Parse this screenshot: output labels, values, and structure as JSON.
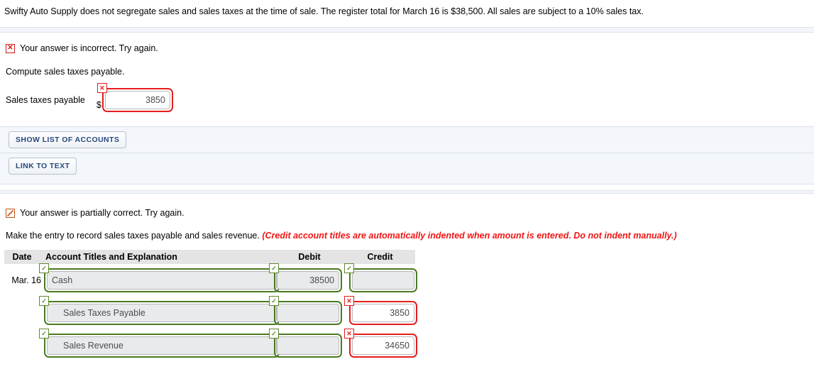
{
  "intro": {
    "text": "Swifty Auto Supply does not segregate sales and sales taxes at the time of sale. The register total for March 16 is $38,500. All sales are subject to a 10% sales tax."
  },
  "part_one": {
    "feedback": {
      "icon": "x-mark-icon",
      "icon_glyph": "✕",
      "text": "Your answer is incorrect.  Try again.",
      "status": "incorrect",
      "color": "#d11a1a"
    },
    "prompt": "Compute sales taxes payable.",
    "field": {
      "label": "Sales taxes payable",
      "currency_symbol": "$",
      "value": "3850",
      "placeholder": "",
      "status": "incorrect",
      "badge_glyph": "✕"
    },
    "buttons": [
      {
        "name": "show-list-of-accounts-button",
        "label": "SHOW LIST OF ACCOUNTS"
      },
      {
        "name": "link-to-text-button",
        "label": "LINK TO TEXT"
      }
    ]
  },
  "part_two": {
    "feedback": {
      "icon": "partial-slash-icon",
      "icon_glyph": "╱",
      "text": "Your answer is partially correct.  Try again.",
      "status": "partial",
      "color": "#c4531a"
    },
    "prompt": "Make the entry to record sales taxes payable and sales revenue.",
    "prompt_note": "(Credit account titles are automatically indented when amount is entered. Do not indent manually.)",
    "table": {
      "headers": [
        "Date",
        "Account Titles and Explanation",
        "Debit",
        "Credit"
      ],
      "rows": [
        {
          "date": "Mar. 16",
          "account": {
            "value": "Cash",
            "status": "ok",
            "badge_glyph": "✓",
            "indent": false
          },
          "debit": {
            "value": "38500",
            "status": "ok",
            "badge_glyph": "✓"
          },
          "credit": {
            "value": "",
            "status": "ok",
            "badge_glyph": "✓"
          }
        },
        {
          "date": "",
          "account": {
            "value": "Sales Taxes Payable",
            "status": "ok",
            "badge_glyph": "✓",
            "indent": true
          },
          "debit": {
            "value": "",
            "status": "ok",
            "badge_glyph": "✓"
          },
          "credit": {
            "value": "3850",
            "status": "err",
            "badge_glyph": "✕"
          }
        },
        {
          "date": "",
          "account": {
            "value": "Sales Revenue",
            "status": "ok",
            "badge_glyph": "✓",
            "indent": true
          },
          "debit": {
            "value": "",
            "status": "ok",
            "badge_glyph": "✓"
          },
          "credit": {
            "value": "34650",
            "status": "err",
            "badge_glyph": "✕"
          }
        }
      ]
    }
  },
  "colors": {
    "error_red": "#e81c1c",
    "ok_green": "#4a7a22",
    "partial_orange": "#c4531a",
    "panel_bg": "#f3f6fa",
    "header_bg": "#e4e4e4",
    "button_text": "#26497d"
  }
}
